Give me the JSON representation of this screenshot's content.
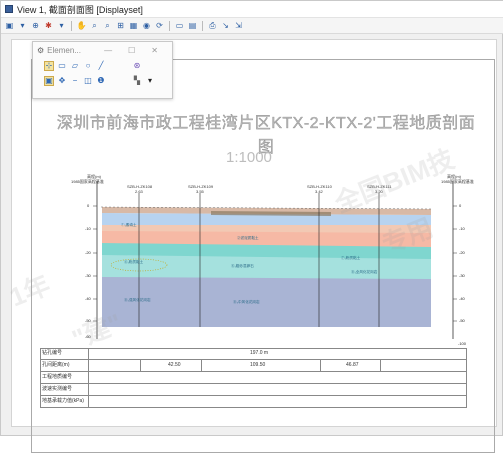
{
  "window": {
    "title": "View 1, 截面剖面图 [Displayset]"
  },
  "toolbar": {
    "icons": [
      "view-icon",
      "dropdown-icon",
      "zoom-icon",
      "gear-icon",
      "dropdown-icon",
      "pan-icon",
      "zoom-in-icon",
      "zoom-out-icon",
      "fit-icon",
      "grid-icon",
      "camera-icon",
      "rotate-icon",
      "window-icon",
      "layers-icon",
      "print-icon",
      "measure-icon",
      "export-icon"
    ]
  },
  "palette": {
    "title": "Elemen...",
    "minimize": "—",
    "maximize": "☐",
    "close": "✕"
  },
  "drawing": {
    "title": "深圳市前海市政工程桂湾片区KTX-2-KTX-2'工程地质剖面图",
    "scale": "1:1000",
    "left_axis_header": "高程(m)",
    "left_axis_sub": "1985国家高程基准",
    "right_axis_header": "高程(m)",
    "right_axis_sub": "1985国家高程基准",
    "boreholes": [
      {
        "id": "SZB-H-ZK108",
        "elev": "2.63"
      },
      {
        "id": "SZB-H-ZK109",
        "elev": "3.55"
      },
      {
        "id": "SZB-H-ZK110",
        "elev": "3.42"
      },
      {
        "id": "SZB-H-ZK111",
        "elev": "3.20"
      }
    ],
    "y_ticks_left": [
      "0",
      "-10",
      "-20",
      "-30",
      "-40",
      "-50",
      "-60"
    ],
    "y_ticks_right": [
      "0",
      "-10",
      "-20",
      "-30",
      "-40",
      "-50",
      "-60"
    ],
    "bottom_tick": "-100"
  },
  "table": {
    "rows": [
      {
        "label": "钻孔编号",
        "values": [
          "197.0 m"
        ]
      },
      {
        "label": "孔间距离(m)",
        "values": [
          "42.50",
          "109.50",
          "46.87"
        ]
      },
      {
        "label": "工程地质编号",
        "values": []
      },
      {
        "label": "波速实测编号",
        "values": []
      },
      {
        "label": "地基承载力值(kPa)",
        "values": []
      }
    ]
  },
  "watermarks": [
    "全国BIM技",
    "专用",
    "1年",
    "\"建\""
  ]
}
